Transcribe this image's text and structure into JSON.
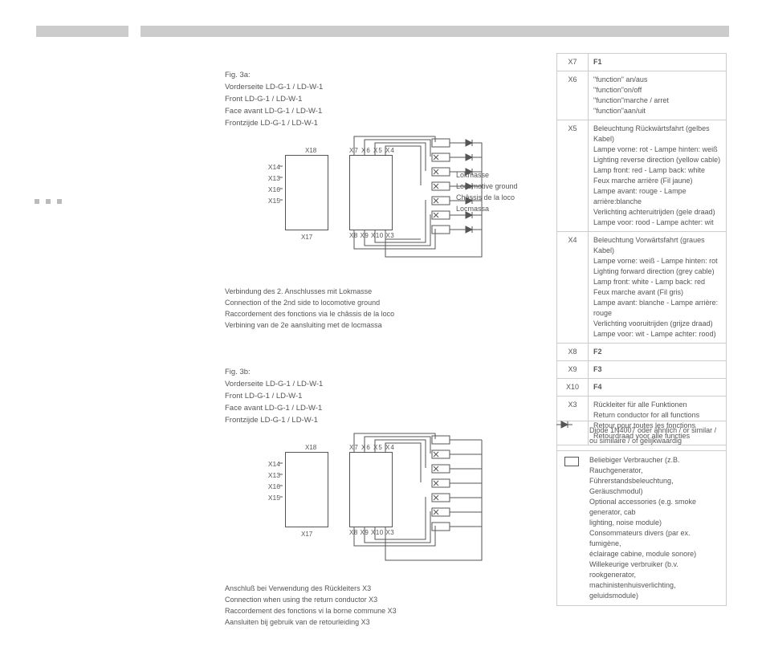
{
  "fig3a": {
    "heading": "Fig. 3a:",
    "l1": "Vorderseite LD-G-1 / LD-W-1",
    "l2": "Front LD-G-1 / LD-W-1",
    "l3": "Face avant LD-G-1 / LD-W-1",
    "l4": "Frontzijde LD-G-1 / LD-W-1",
    "leftpins": "X14\nX13\nX16\nX15",
    "x18": "X18",
    "x17": "X17",
    "toppins": "X7 X6 X5 X4",
    "botpins": "X8 X9 X10 X3",
    "rlabel": "Lokmasse\nLocomotive ground\nChâssis de la loco\nLocmassa",
    "cap1": "Verbindung des 2. Anschlusses mit Lokmasse",
    "cap2": "Connection of the 2nd side to locomotive ground",
    "cap3": "Raccordement des fonctions via le châssis de la loco",
    "cap4": "Verbining van de 2e aansluiting met de locmassa"
  },
  "fig3b": {
    "heading": "Fig. 3b:",
    "l1": "Vorderseite LD-G-1 / LD-W-1",
    "l2": "Front LD-G-1 / LD-W-1",
    "l3": "Face avant LD-G-1 / LD-W-1",
    "l4": "Frontzijde LD-G-1 / LD-W-1",
    "leftpins": "X14\nX13\nX16\nX15",
    "x18": "X18",
    "x17": "X17",
    "toppins": "X7 X6 X5 X4",
    "botpins": "X8 X9 X10 X3",
    "cap1": "Anschluß bei Verwendung des Rückleiters X3",
    "cap2": "Connection when using the return conductor X3",
    "cap3": "Raccordement des fonctions vi la borne commune X3",
    "cap4": "Aansluiten bij gebruik van de retourleiding X3"
  },
  "table": {
    "r1k": "X7",
    "r1v": "F1",
    "r2k": "X6",
    "r2v": "\"function\" an/aus\n\"function\"on/off\n\"function\"marche / arret\n\"function\"aan/uit",
    "r3k": "X5",
    "r3v": "Beleuchtung Rückwärtsfahrt (gelbes Kabel)\nLampe vorne: rot - Lampe hinten: weiß\nLighting reverse direction (yellow cable)\nLamp front: red - Lamp back: white\nFeux marche arrière (Fil jaune)\nLampe avant: rouge - Lampe arrière:blanche\nVerlichting achteruitrijden (gele draad)\nLampe voor: rood - Lampe achter: wit",
    "r4k": "X4",
    "r4v": "Beleuchtung Vorwärtsfahrt (graues Kabel)\nLampe vorne: weiß - Lampe hinten: rot\nLighting forward direction (grey cable)\nLamp front: white - Lamp back: red\nFeux marche avant (Fil gris)\nLampe avant: blanche - Lampe arrière: rouge\nVerlichting vooruitrijden (grijze draad)\nLampe voor: wit - Lampe achter: rood)",
    "r5k": "X8",
    "r5v": "F2",
    "r6k": "X9",
    "r6v": "F3",
    "r7k": "X10",
    "r7v": "F4",
    "r8k": "X3",
    "r8v": "Rückleiter für alle Funktionen\nReturn conductor for all functions\nRetour pour toutes les fonctions\nRetourdraad voor alle functies"
  },
  "legend": {
    "diode": "Diode 1N4007 oder ähnlich / or similar /\nou similaire / of gelijkwaardig",
    "consumer": "Beliebiger Verbraucher (z.B. Rauchgenerator,\nFührerstandsbeleuchtung, Geräuschmodul)\nOptional accessories (e.g. smoke generator, cab\nlighting, noise module)\nConsommateurs divers (par ex. fumigène,\néclairage cabine, module sonore)\nWillekeurige verbruiker (b.v. rookgenerator,\nmachinistenhuisverlichting, geluidsmodule)"
  }
}
